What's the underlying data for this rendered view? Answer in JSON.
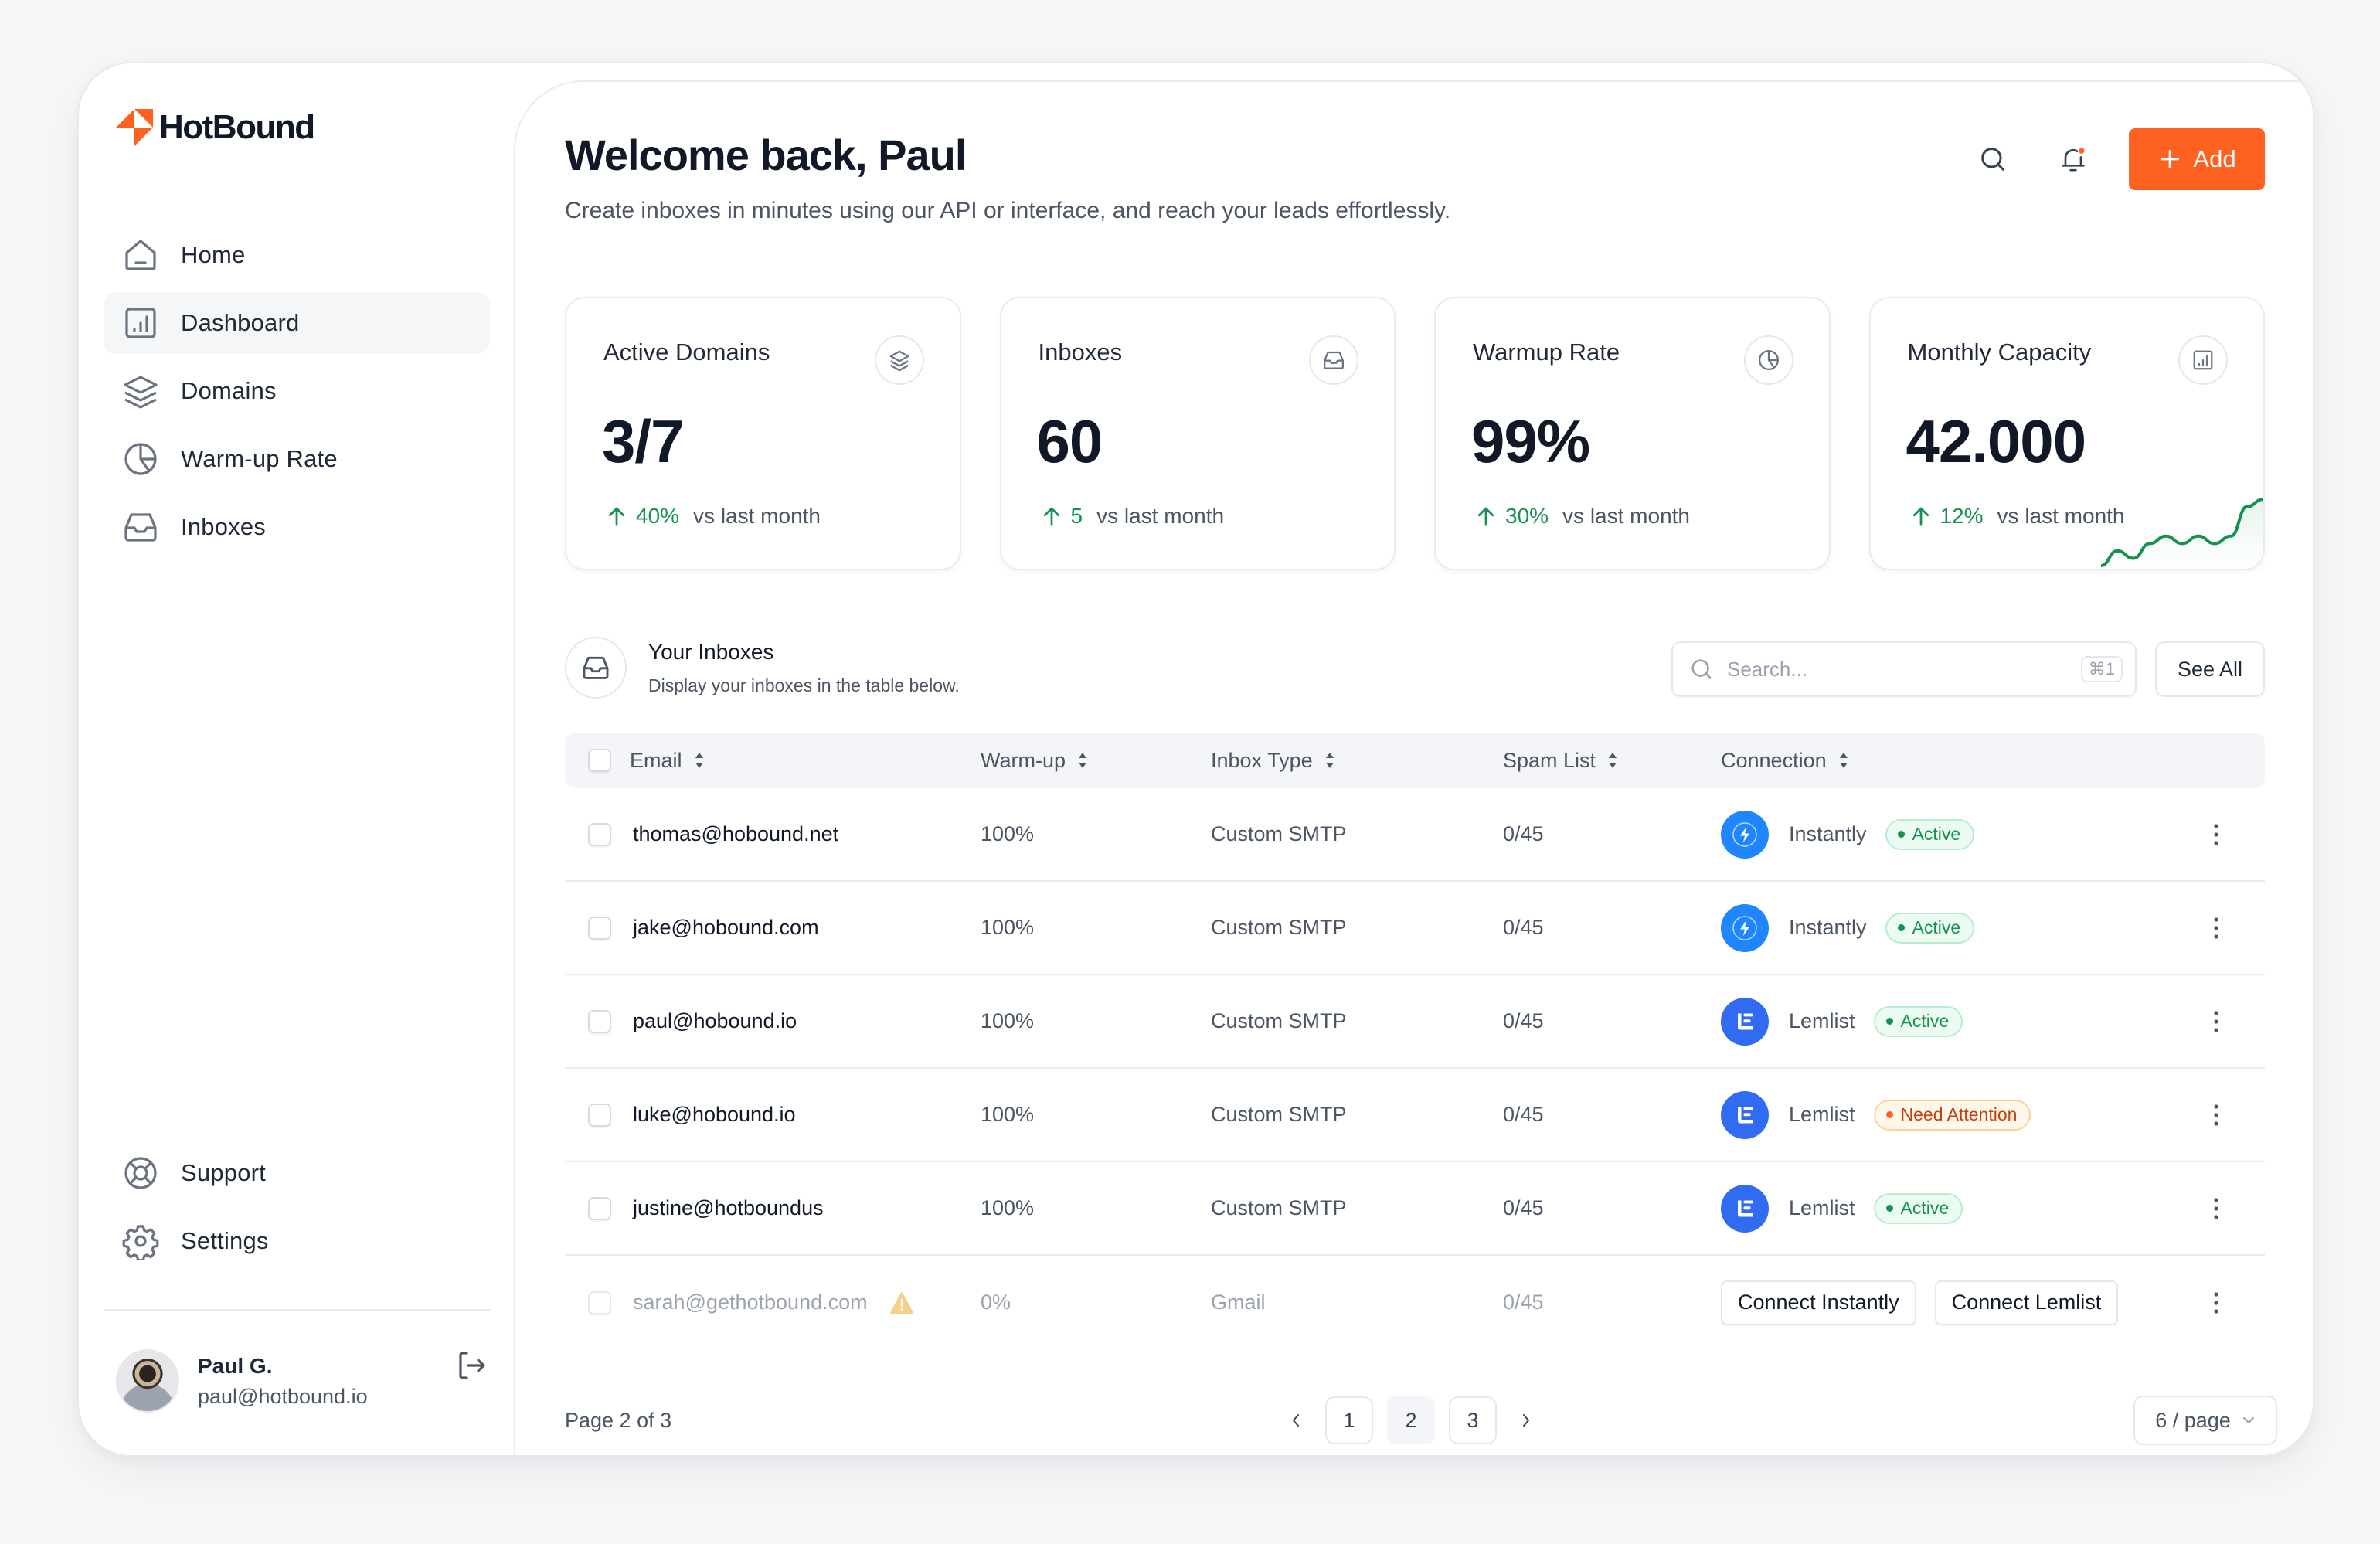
{
  "app": {
    "brand": "HotBound",
    "brand_color": "#FF6120"
  },
  "sidebar": {
    "items": [
      {
        "label": "Home",
        "icon": "home-icon",
        "active": false
      },
      {
        "label": "Dashboard",
        "icon": "bar-chart-icon",
        "active": true
      },
      {
        "label": "Domains",
        "icon": "layers-icon",
        "active": false
      },
      {
        "label": "Warm-up Rate",
        "icon": "pie-chart-icon",
        "active": false
      },
      {
        "label": "Inboxes",
        "icon": "inbox-icon",
        "active": false
      }
    ],
    "bottom_items": [
      {
        "label": "Support",
        "icon": "lifebuoy-icon"
      },
      {
        "label": "Settings",
        "icon": "gear-icon"
      }
    ],
    "user": {
      "name": "Paul G.",
      "email": "paul@hotbound.io"
    }
  },
  "header": {
    "title": "Welcome back, Paul",
    "subtitle": "Create inboxes in minutes using our API or interface, and reach your leads effortlessly.",
    "add_label": "Add"
  },
  "stats": [
    {
      "label": "Active Domains",
      "value": "3/7",
      "trend": "40%",
      "trend_label": "vs last month",
      "icon": "layers-icon"
    },
    {
      "label": "Inboxes",
      "value": "60",
      "trend": "5",
      "trend_label": "vs last month",
      "icon": "inbox-icon"
    },
    {
      "label": "Warmup Rate",
      "value": "99%",
      "trend": "30%",
      "trend_label": "vs last month",
      "icon": "pie-chart-icon"
    },
    {
      "label": "Monthly Capacity",
      "value": "42.000",
      "trend": "12%",
      "trend_label": "vs last month",
      "icon": "bar-chart-icon",
      "sparkline": [
        2,
        4,
        3,
        5,
        6,
        5,
        6,
        5,
        6,
        10,
        11
      ]
    }
  ],
  "inboxes": {
    "title": "Your Inboxes",
    "subtitle": "Display your inboxes in the table below.",
    "search_placeholder": "Search...",
    "search_shortcut": "⌘1",
    "see_all_label": "See All",
    "columns": [
      "Email",
      "Warm-up",
      "Inbox Type",
      "Spam List",
      "Connection"
    ],
    "rows": [
      {
        "email": "thomas@hobound.net",
        "warmup": "100%",
        "type": "Custom SMTP",
        "spam": "0/45",
        "connection": "Instantly",
        "status": "Active",
        "status_kind": "active"
      },
      {
        "email": "jake@hobound.com",
        "warmup": "100%",
        "type": "Custom SMTP",
        "spam": "0/45",
        "connection": "Instantly",
        "status": "Active",
        "status_kind": "active"
      },
      {
        "email": "paul@hobound.io",
        "warmup": "100%",
        "type": "Custom SMTP",
        "spam": "0/45",
        "connection": "Lemlist",
        "status": "Active",
        "status_kind": "active"
      },
      {
        "email": "luke@hobound.io",
        "warmup": "100%",
        "type": "Custom SMTP",
        "spam": "0/45",
        "connection": "Lemlist",
        "status": "Need Attention",
        "status_kind": "attention"
      },
      {
        "email": "justine@hotboundus",
        "warmup": "100%",
        "type": "Custom SMTP",
        "spam": "0/45",
        "connection": "Lemlist",
        "status": "Active",
        "status_kind": "active"
      },
      {
        "email": "sarah@gethotbound.com",
        "warmup": "0%",
        "type": "Gmail",
        "spam": "0/45",
        "connect_instantly_label": "Connect Instantly",
        "connect_lemlist_label": "Connect Lemlist",
        "warning": true
      }
    ],
    "pagination": {
      "label": "Page 2 of 3",
      "pages": [
        "1",
        "2",
        "3"
      ],
      "current": "2",
      "per_page": "6 / page"
    }
  }
}
